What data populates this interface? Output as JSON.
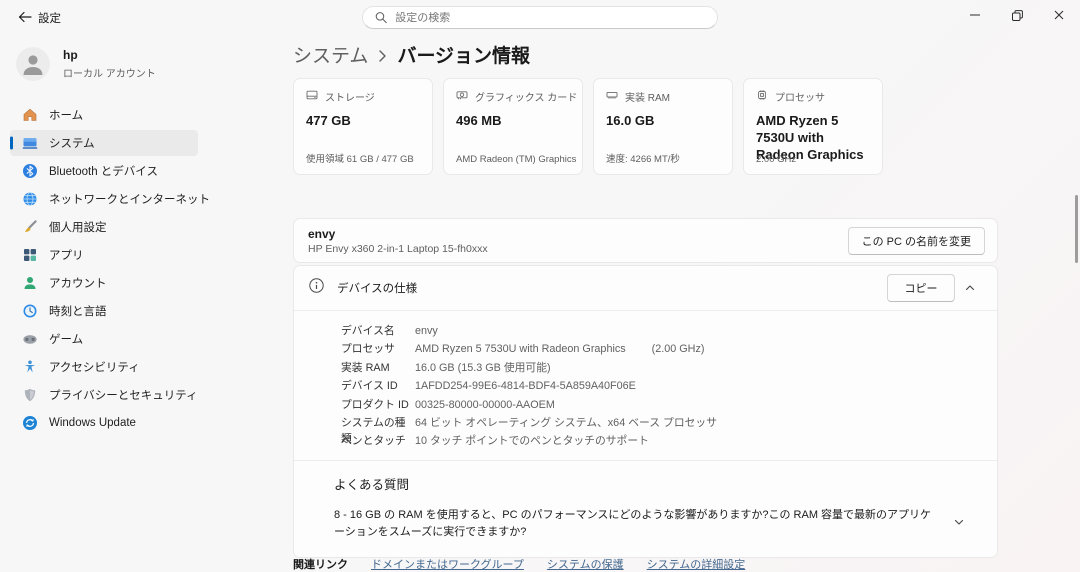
{
  "titlebar": {
    "app_title": "設定",
    "search_placeholder": "設定の検索"
  },
  "user": {
    "name": "hp",
    "account_type": "ローカル アカウント"
  },
  "sidebar": {
    "items": [
      {
        "icon": "home-icon",
        "label": "ホーム",
        "selected": false
      },
      {
        "icon": "system-icon",
        "label": "システム",
        "selected": true
      },
      {
        "icon": "bluetooth-icon",
        "label": "Bluetooth とデバイス",
        "selected": false
      },
      {
        "icon": "network-icon",
        "label": "ネットワークとインターネット",
        "selected": false
      },
      {
        "icon": "personalization-icon",
        "label": "個人用設定",
        "selected": false
      },
      {
        "icon": "apps-icon",
        "label": "アプリ",
        "selected": false
      },
      {
        "icon": "accounts-icon",
        "label": "アカウント",
        "selected": false
      },
      {
        "icon": "time-language-icon",
        "label": "時刻と言語",
        "selected": false
      },
      {
        "icon": "gaming-icon",
        "label": "ゲーム",
        "selected": false
      },
      {
        "icon": "accessibility-icon",
        "label": "アクセシビリティ",
        "selected": false
      },
      {
        "icon": "privacy-icon",
        "label": "プライバシーとセキュリティ",
        "selected": false
      },
      {
        "icon": "windows-update-icon",
        "label": "Windows Update",
        "selected": false
      }
    ]
  },
  "breadcrumb": {
    "parent": "システム",
    "current": "バージョン情報"
  },
  "cards": [
    {
      "icon": "storage-icon",
      "label": "ストレージ",
      "value": "477 GB",
      "caption": "使用領域 61 GB / 477 GB"
    },
    {
      "icon": "gpu-icon",
      "label": "グラフィックス カード",
      "value": "496 MB",
      "caption": "AMD Radeon (TM) Graphics"
    },
    {
      "icon": "ram-icon",
      "label": "実装 RAM",
      "value": "16.0 GB",
      "caption": "速度: 4266 MT/秒"
    },
    {
      "icon": "cpu-icon",
      "label": "プロセッサ",
      "value": "AMD Ryzen 5 7530U with Radeon Graphics",
      "caption": "2.00 GHz"
    }
  ],
  "device": {
    "name": "envy",
    "model": "HP Envy x360 2-in-1 Laptop 15-fh0xxx",
    "rename_button": "この PC の名前を変更"
  },
  "specs": {
    "title": "デバイスの仕様",
    "copy_button": "コピー",
    "rows": [
      {
        "label": "デバイス名",
        "value": "envy"
      },
      {
        "label": "プロセッサ",
        "value": "AMD Ryzen 5 7530U with Radeon Graphics",
        "extra": "(2.00 GHz)"
      },
      {
        "label": "実装 RAM",
        "value": "16.0 GB (15.3 GB 使用可能)"
      },
      {
        "label": "デバイス ID",
        "value": "1AFDD254-99E6-4814-BDF4-5A859A40F06E"
      },
      {
        "label": "プロダクト ID",
        "value": "00325-80000-00000-AAOEM"
      },
      {
        "label": "システムの種類",
        "value": "64 ビット オペレーティング システム、x64 ベース プロセッサ"
      },
      {
        "label": "ペンとタッチ",
        "value": "10 タッチ ポイントでのペンとタッチのサポート"
      }
    ]
  },
  "faq": {
    "title": "よくある質問",
    "question": "8 - 16 GB の RAM を使用すると、PC のパフォーマンスにどのような影響がありますか?この RAM 容量で最新のアプリケーションをスムーズに実行できますか?"
  },
  "related": {
    "label": "関連リンク",
    "links": [
      "ドメインまたはワークグループ",
      "システムの保護",
      "システムの詳細設定"
    ]
  },
  "colors": {
    "accent": "#0067c0",
    "link": "#44688f"
  }
}
